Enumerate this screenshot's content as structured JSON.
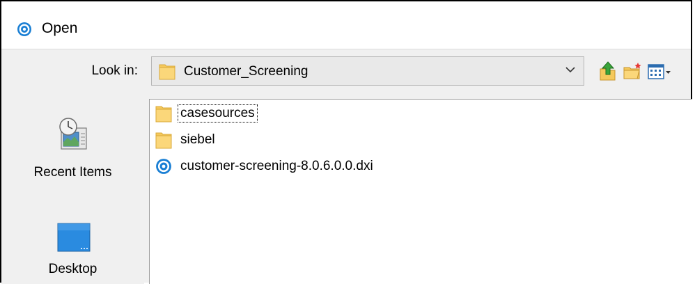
{
  "window": {
    "title": "Open"
  },
  "lookin": {
    "label": "Look in:",
    "value": "Customer_Screening"
  },
  "toolbar": {
    "icons": [
      "up-one-level-icon",
      "new-folder-icon",
      "view-menu-icon"
    ]
  },
  "places": [
    {
      "label": "Recent Items",
      "icon": "recent-items-icon"
    },
    {
      "label": "Desktop",
      "icon": "desktop-icon"
    }
  ],
  "files": [
    {
      "name": "casesources",
      "type": "folder",
      "focused": true
    },
    {
      "name": "siebel",
      "type": "folder",
      "focused": false
    },
    {
      "name": "customer-screening-8.0.6.0.0.dxi",
      "type": "dxi-file",
      "focused": false
    }
  ],
  "colors": {
    "folder": "#f5c95c",
    "app_blue": "#1a7fd4",
    "desktop_blue": "#2a8be0"
  }
}
